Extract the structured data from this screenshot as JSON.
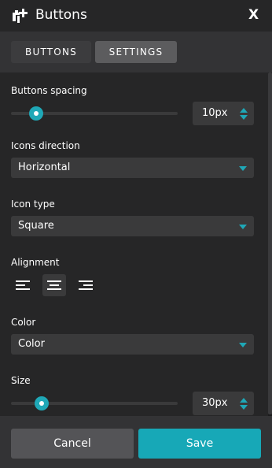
{
  "header": {
    "title": "Buttons",
    "close_label": "X",
    "logo_icon": "elementor-plus-icon"
  },
  "tabs": [
    {
      "label": "BUTTONS",
      "active": false
    },
    {
      "label": "SETTINGS",
      "active": true
    }
  ],
  "settings": {
    "spacing": {
      "label": "Buttons spacing",
      "value": "10px",
      "slider_level": 0.11
    },
    "icons_direction": {
      "label": "Icons direction",
      "value": "Horizontal"
    },
    "icon_type": {
      "label": "Icon type",
      "value": "Square"
    },
    "alignment": {
      "label": "Alignment",
      "options": [
        "left",
        "center",
        "right"
      ],
      "selected": "center"
    },
    "color": {
      "label": "Color",
      "value": "Color"
    },
    "size": {
      "label": "Size",
      "value": "30px",
      "slider_level": 0.14
    }
  },
  "footer": {
    "cancel_label": "Cancel",
    "save_label": "Save"
  },
  "colors": {
    "accent": "#1fa8b7",
    "background": "#262627",
    "panel": "#333335",
    "input": "#3a3a3b"
  }
}
